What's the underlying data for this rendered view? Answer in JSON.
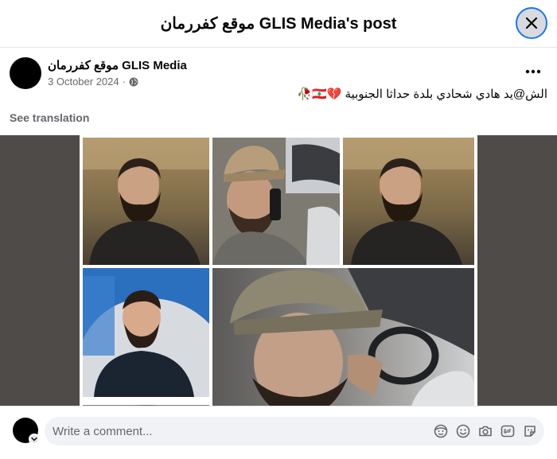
{
  "header": {
    "title": "موقع كفررمان GLIS Media's post"
  },
  "post": {
    "author": "موقع كفررمان GLIS Media",
    "date": "3 October 2024",
    "separator": "·",
    "text": "الش@يد هادي  شحادي بلدة حداثا الجنوبية 💔🇱🇧🥀",
    "see_translation": "See translation"
  },
  "footer": {
    "comment_placeholder": "Write a comment..."
  },
  "icons": {
    "close": "close-icon",
    "more": "more-options-icon",
    "privacy": "globe-icon",
    "avatar_badge": "chevron-down-icon",
    "comment_tools": [
      "avatar-sticker-icon",
      "emoji-icon",
      "camera-icon",
      "gif-icon",
      "sticker-icon"
    ]
  },
  "colors": {
    "accent": "#1877f2",
    "secondary_text": "#65676b",
    "media_background": "#4e4b49",
    "comment_box": "#f0f2f5"
  }
}
